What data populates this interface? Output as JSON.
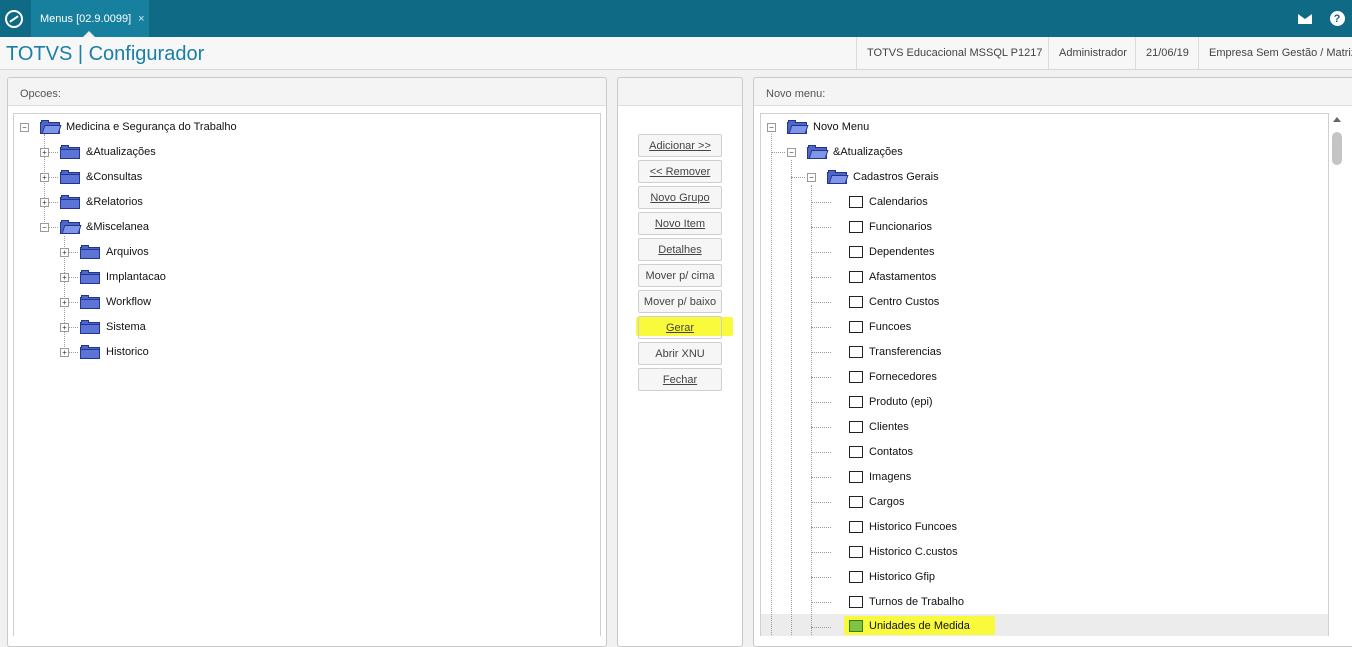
{
  "topbar": {
    "tab_label": "Menus [02.9.0099]",
    "tab_close": "×",
    "help_glyph": "?"
  },
  "header": {
    "app_title": "TOTVS | Configurador",
    "environment": "TOTVS Educacional MSSQL P1217",
    "user": "Administrador",
    "date": "21/06/19",
    "company": "Empresa Sem Gestão / Matriz"
  },
  "left_panel": {
    "title": "Opcoes:",
    "root": "Medicina e Segurança do Trabalho",
    "items": [
      "&Atualizações",
      "&Consultas",
      "&Relatorios",
      "&Miscelanea"
    ],
    "misc_children": [
      "Arquivos",
      "Implantacao",
      "Workflow",
      "Sistema",
      "Historico"
    ]
  },
  "buttons": {
    "add": "Adicionar >>",
    "remove": "<< Remover",
    "new_group": "Novo Grupo",
    "new_item": "Novo Item",
    "details": "Detalhes",
    "move_up": "Mover p/ cima",
    "move_down": "Mover p/ baixo",
    "generate": "Gerar",
    "open_xnu": "Abrir XNU",
    "close": "Fechar"
  },
  "right_panel": {
    "title": "Novo menu:",
    "root": "Novo Menu",
    "group": "&Atualizações",
    "subgroup": "Cadastros Gerais",
    "items": [
      "Calendarios",
      "Funcionarios",
      "Dependentes",
      "Afastamentos",
      "Centro Custos",
      "Funcoes",
      "Transferencias",
      "Fornecedores",
      "Produto (epi)",
      "Clientes",
      "Contatos",
      "Imagens",
      "Cargos",
      "Historico Funcoes",
      "Historico C.custos",
      "Historico Gfip",
      "Turnos de Trabalho",
      "Unidades de Medida"
    ]
  },
  "colors": {
    "topbar": "#0f6a85",
    "accent": "#1a7fa3",
    "highlight": "#fafa3c",
    "folder": "#4d67c9"
  }
}
